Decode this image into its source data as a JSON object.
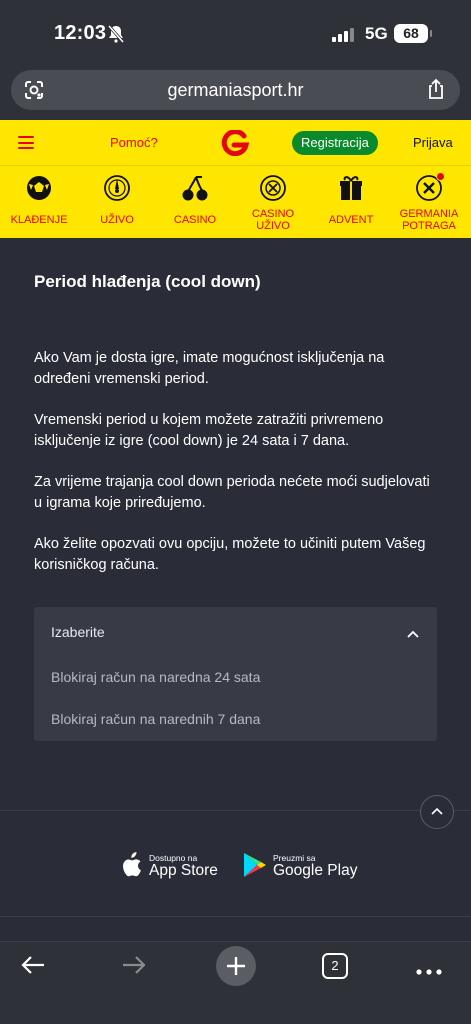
{
  "status_bar": {
    "time": "12:03",
    "network": "5G",
    "battery": "68"
  },
  "browser": {
    "url": "germaniasport.hr",
    "tab_count": "2"
  },
  "header": {
    "help_label": "Pomoć?",
    "register_label": "Registracija",
    "login_label": "Prijava"
  },
  "categories": [
    {
      "label": "KLAĐENJE"
    },
    {
      "label": "UŽIVO"
    },
    {
      "label": "CASINO"
    },
    {
      "label": "CASINO UŽIVO"
    },
    {
      "label": "ADVENT"
    },
    {
      "label": "GERMANIA POTRAGA"
    }
  ],
  "page": {
    "title": "Period hlađenja (cool down)",
    "paragraphs": [
      "Ako Vam je dosta igre, imate mogućnost isključenja na određeni vremenski period.",
      "Vremenski period u kojem možete zatražiti privremeno isključenje iz igre (cool down) je 24 sata i 7 dana.",
      "Za vrijeme trajanja cool down perioda nećete moći sudjelovati u igrama koje priređujemo.",
      "Ako želite opozvati ovu opciju, možete to učiniti putem Vašeg korisničkog računa."
    ],
    "dropdown": {
      "label": "Izaberite",
      "options": [
        "Blokiraj račun na naredna 24 sata",
        "Blokiraj račun na narednih 7 dana"
      ]
    }
  },
  "footer": {
    "app_store": {
      "small": "Dostupno na",
      "big": "App Store"
    },
    "google_play": {
      "small": "Preuzmi sa",
      "big": "Google Play"
    }
  },
  "colors": {
    "brand_yellow": "#ffe600",
    "brand_red": "#e30613",
    "register_green": "#0a8a2a",
    "background": "#2a2d37"
  }
}
